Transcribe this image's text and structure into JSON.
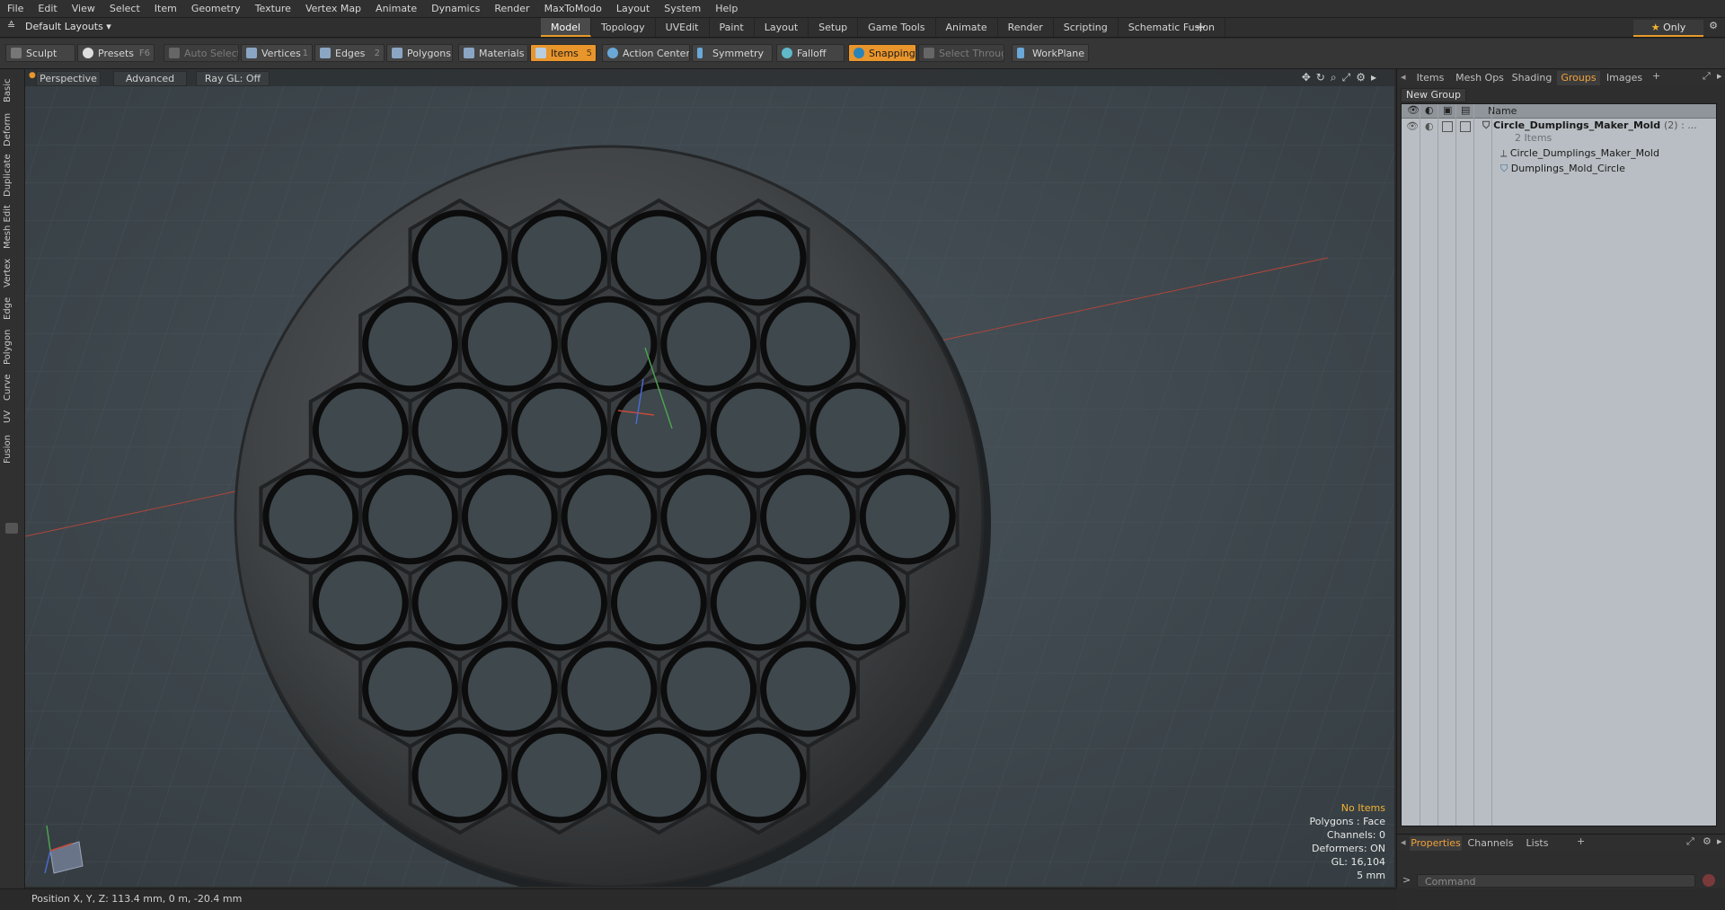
{
  "menu": [
    "File",
    "Edit",
    "View",
    "Select",
    "Item",
    "Geometry",
    "Texture",
    "Vertex Map",
    "Animate",
    "Dynamics",
    "Render",
    "MaxToModo",
    "Layout",
    "System",
    "Help"
  ],
  "layout_dropdown": "Default Layouts ▾",
  "layout_tabs": [
    {
      "label": "Model",
      "active": true
    },
    {
      "label": "Topology"
    },
    {
      "label": "UVEdit"
    },
    {
      "label": "Paint"
    },
    {
      "label": "Layout"
    },
    {
      "label": "Setup"
    },
    {
      "label": "Game Tools"
    },
    {
      "label": "Animate"
    },
    {
      "label": "Render"
    },
    {
      "label": "Scripting"
    },
    {
      "label": "Schematic Fusion"
    }
  ],
  "only_label": "Only",
  "toolbar": {
    "sculpt": "Sculpt",
    "presets": "Presets",
    "presets_key": "F6",
    "auto_select": "Auto Select",
    "vertices": "Vertices",
    "vertices_count": "1",
    "edges": "Edges",
    "edges_count": "2",
    "polygons": "Polygons",
    "materials": "Materials",
    "items": "Items",
    "items_count": "5",
    "action_center": "Action Center",
    "symmetry": "Symmetry",
    "falloff": "Falloff",
    "snapping": "Snapping",
    "select_through": "Select Through",
    "workplane": "WorkPlane"
  },
  "left_tabs": [
    "Basic",
    "Deform",
    "Duplicate",
    "Mesh Edit",
    "Vertex",
    "Edge",
    "Polygon",
    "Curve",
    "UV",
    "Fusion"
  ],
  "viewport": {
    "perspective": "Perspective",
    "advanced": "Advanced",
    "raygl": "Ray GL: Off",
    "info": {
      "no_items": "No Items",
      "polygons": "Polygons : Face",
      "channels": "Channels: 0",
      "deformers": "Deformers: ON",
      "gl": "GL: 16,104",
      "scale": "5 mm"
    }
  },
  "right_panel": {
    "tabs": [
      {
        "label": "Items"
      },
      {
        "label": "Mesh Ops"
      },
      {
        "label": "Shading"
      },
      {
        "label": "Groups",
        "active": true
      },
      {
        "label": "Images"
      }
    ],
    "new_group": "New Group",
    "name_header": "Name",
    "group_name": "Circle_Dumplings_Maker_Mold",
    "group_count": "(2) : ...",
    "group_sub": "2 Items",
    "children": [
      "Circle_Dumplings_Maker_Mold",
      "Dumplings_Mold_Circle"
    ],
    "bottom_tabs": [
      {
        "label": "Properties",
        "active": true
      },
      {
        "label": "Channels"
      },
      {
        "label": "Lists"
      }
    ],
    "command_placeholder": "Command"
  },
  "status": "Position X, Y, Z:   113.4 mm, 0 m, -20.4 mm",
  "colors": {
    "accent": "#e8952c",
    "viewport_bg": "#3d464b",
    "panel_bg": "#2e2e2e",
    "tree_bg": "#b8bec3"
  }
}
